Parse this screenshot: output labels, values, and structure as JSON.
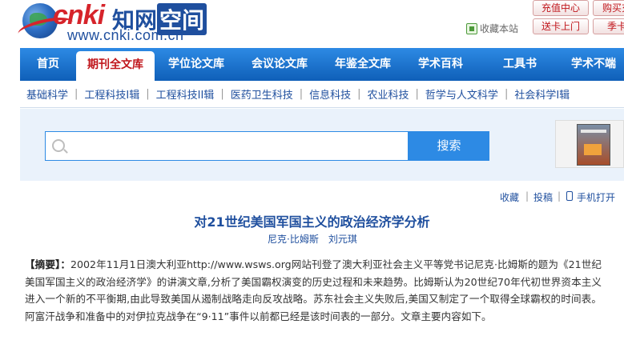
{
  "header": {
    "logo_brand": "cnki",
    "logo_cn": "知网",
    "logo_cn_box": "空间",
    "logo_url": "www.cnki.com.cn",
    "favorite_label": "收藏本站",
    "buttons": [
      "充值中心",
      "购买充",
      "送卡上门",
      "季卡"
    ]
  },
  "nav": {
    "items": [
      "首页",
      "期刊全文库",
      "学位论文库",
      "会议论文库",
      "年鉴全文库",
      "学术百科",
      "工具书",
      "学术不端"
    ],
    "active_index": 1
  },
  "subnav": {
    "items": [
      "基础科学",
      "工程科技I辑",
      "工程科技II辑",
      "医药卫生科技",
      "信息科技",
      "农业科技",
      "哲学与人文科学",
      "社会科学I辑"
    ]
  },
  "search": {
    "placeholder": "",
    "button_label": "搜索"
  },
  "tools": {
    "favorite": "收藏",
    "submit": "投稿",
    "mobile": "手机打开"
  },
  "article": {
    "title": "对21世纪美国军国主义的政治经济学分析",
    "authors": [
      "尼克·比姆斯",
      "刘元琪"
    ],
    "abstract_label": "【摘要】：",
    "abstract": "2002年11月1日澳大利亚http://www.wsws.org网站刊登了澳大利亚社会主义平等党书记尼克·比姆斯的题为《21世纪美国军国主义的政治经济学》的讲演文章,分析了美国霸权演变的历史过程和未来趋势。比姆斯认为20世纪70年代初世界资本主义进入一个新的不平衡期,由此导致美国从遏制战略走向反攻战略。苏东社会主义失败后,美国又制定了一个取得全球霸权的时间表。阿富汗战争和准备中的对伊拉克战争在“9·11”事件以前都已经是该时间表的一部分。文章主要内容如下。"
  }
}
